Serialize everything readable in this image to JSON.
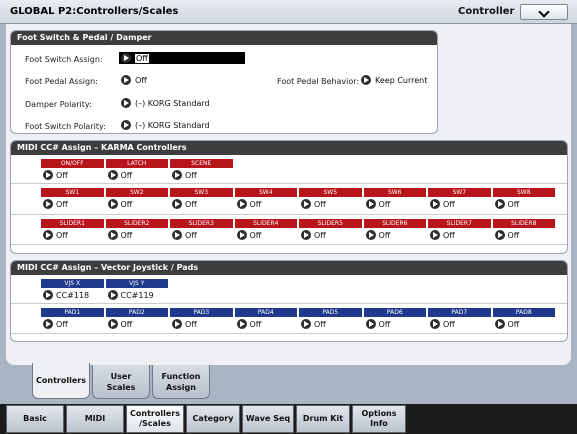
{
  "header": {
    "title": "GLOBAL P2:Controllers/Scales",
    "controller_label": "Controller"
  },
  "foot": {
    "title": "Foot Switch & Pedal / Damper",
    "switch_assign_label": "Foot Switch Assign:",
    "switch_assign_value": "Off",
    "pedal_assign_label": "Foot Pedal Assign:",
    "pedal_assign_value": "Off",
    "pedal_behavior_label": "Foot Pedal Behavior:",
    "pedal_behavior_value": "Keep Current",
    "damper_polarity_label": "Damper Polarity:",
    "damper_polarity_value": "(–) KORG Standard",
    "switch_polarity_label": "Foot Switch Polarity:",
    "switch_polarity_value": "(–) KORG Standard"
  },
  "karma": {
    "title": "MIDI CC# Assign – KARMA Controllers",
    "top_headers": [
      "ON/OFF",
      "LATCH",
      "SCENE"
    ],
    "top_values": [
      "Off",
      "Off",
      "Off"
    ],
    "sw_headers": [
      "SW1",
      "SW2",
      "SW3",
      "SW4",
      "SW5",
      "SW6",
      "SW7",
      "SW8"
    ],
    "sw_values": [
      "Off",
      "Off",
      "Off",
      "Off",
      "Off",
      "Off",
      "Off",
      "Off"
    ],
    "slider_headers": [
      "SLIDER1",
      "SLIDER2",
      "SLIDER3",
      "SLIDER4",
      "SLIDER5",
      "SLIDER6",
      "SLIDER7",
      "SLIDER8"
    ],
    "slider_values": [
      "Off",
      "Off",
      "Off",
      "Off",
      "Off",
      "Off",
      "Off",
      "Off"
    ]
  },
  "vector": {
    "title": "MIDI CC# Assign – Vector Joystick / Pads",
    "vjs_headers": [
      "VJS X",
      "VJS Y"
    ],
    "vjs_values": [
      "CC#118",
      "CC#119"
    ],
    "pad_headers": [
      "PAD1",
      "PAD2",
      "PAD3",
      "PAD4",
      "PAD5",
      "PAD6",
      "PAD7",
      "PAD8"
    ],
    "pad_values": [
      "Off",
      "Off",
      "Off",
      "Off",
      "Off",
      "Off",
      "Off",
      "Off"
    ]
  },
  "subtabs": [
    {
      "line1": "Controllers",
      "line2": ""
    },
    {
      "line1": "User",
      "line2": "Scales"
    },
    {
      "line1": "Function",
      "line2": "Assign"
    }
  ],
  "maintabs": [
    {
      "line1": "Basic",
      "line2": ""
    },
    {
      "line1": "MIDI",
      "line2": ""
    },
    {
      "line1": "Controllers",
      "line2": "/Scales"
    },
    {
      "line1": "Category",
      "line2": ""
    },
    {
      "line1": "Wave Seq",
      "line2": ""
    },
    {
      "line1": "Drum Kit",
      "line2": ""
    },
    {
      "line1": "Options",
      "line2": "Info"
    }
  ],
  "colors": {
    "karma_header": "#b8141c",
    "vector_header": "#1f3a8c",
    "section_title_bg": "#3d3d3d"
  }
}
